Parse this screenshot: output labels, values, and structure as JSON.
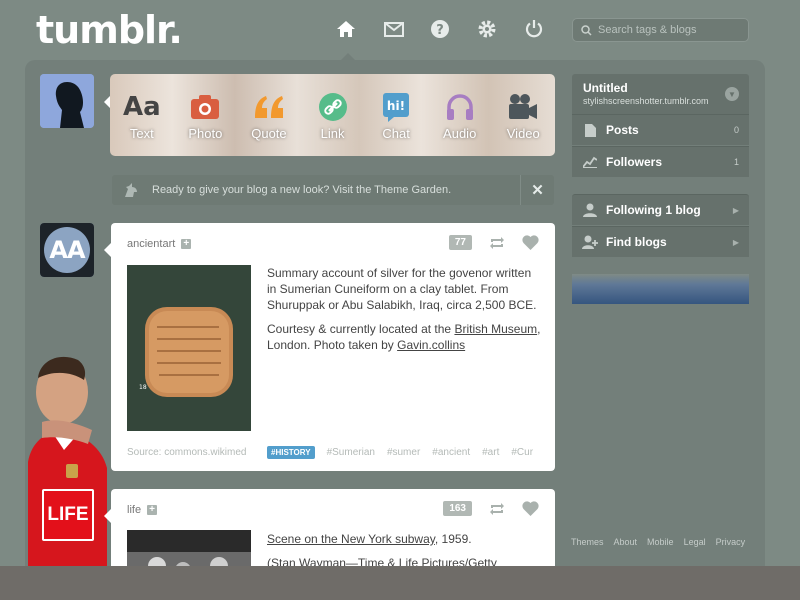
{
  "header": {
    "logo_text": "tumblr.",
    "search_placeholder": "Search tags & blogs"
  },
  "post_types": [
    {
      "label": "Text",
      "icon": "text-icon",
      "color": "#444444"
    },
    {
      "label": "Photo",
      "icon": "camera-icon",
      "color": "#d95e40"
    },
    {
      "label": "Quote",
      "icon": "quote-icon",
      "color": "#f2992e"
    },
    {
      "label": "Link",
      "icon": "link-icon",
      "color": "#56bc8a"
    },
    {
      "label": "Chat",
      "icon": "chat-icon",
      "color": "#529ecc"
    },
    {
      "label": "Audio",
      "icon": "headphones-icon",
      "color": "#a77dc2"
    },
    {
      "label": "Video",
      "icon": "video-camera-icon",
      "color": "#748089"
    }
  ],
  "notice": {
    "message": "Ready to give your blog a new look? Visit the Theme Garden.",
    "close": "✕"
  },
  "posts": [
    {
      "blog": "ancientart",
      "notes": "77",
      "paragraph1": "Summary account of silver for the govenor written in Sumerian Cuneiform on a clay tablet. From Shuruppak or Abu Salabikh, Iraq, circa 2,500 BCE.",
      "p2_before": "Courtesy & currently located at the ",
      "p2_link1": "British Museum",
      "p2_middle": ", London. Photo taken by ",
      "p2_link2": "Gavin.collins",
      "source": "Source: commons.wikimed",
      "featured_tag": "#HISTORY",
      "tags": [
        "#Sumerian",
        "#sumer",
        "#ancient",
        "#art",
        "#Cur"
      ]
    },
    {
      "blog": "life",
      "notes": "163",
      "caption_link": "Scene on the New York subway",
      "caption_rest": ", 1959.",
      "credit": "(Stan Wayman—Time & Life Pictures/Getty Images)"
    }
  ],
  "avatar_life_text": "LIFE",
  "sidebar": {
    "blog_title": "Untitled",
    "blog_url": "stylishscreenshotter.tumblr.com",
    "rows": [
      {
        "label": "Posts",
        "count": "0",
        "icon": "posts-icon"
      },
      {
        "label": "Followers",
        "count": "1",
        "icon": "followers-icon"
      }
    ],
    "following": "Following 1 blog",
    "find": "Find blogs"
  },
  "footer": [
    "Themes",
    "About",
    "Mobile",
    "Legal",
    "Privacy"
  ]
}
